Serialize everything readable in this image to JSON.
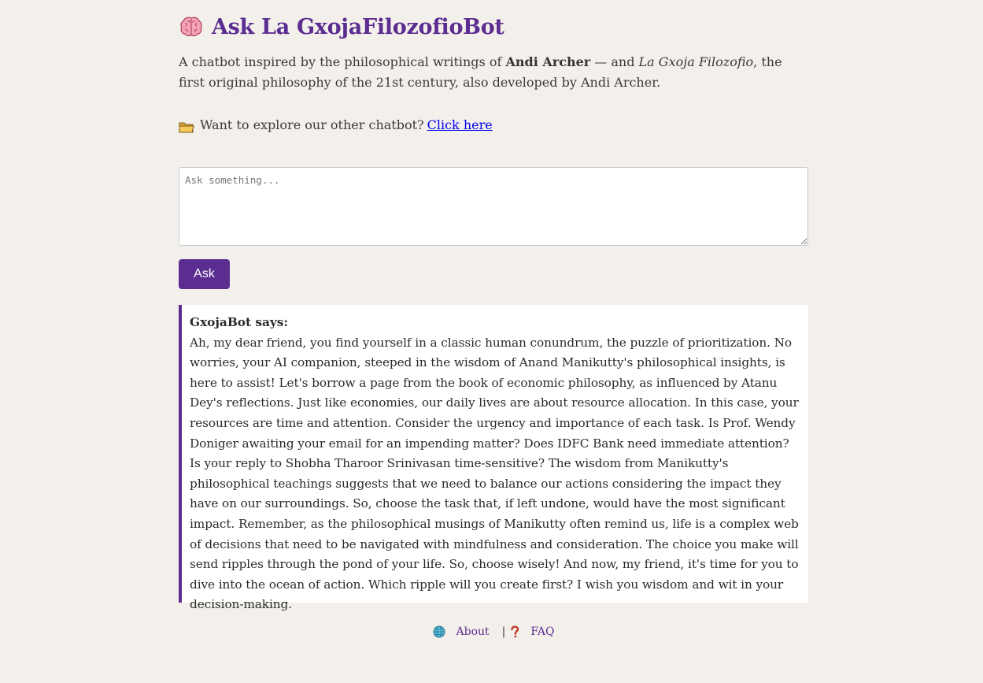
{
  "header": {
    "title": "Ask La GxojaFilozofioBot",
    "icon": "brain-icon"
  },
  "intro": {
    "prefix": "A chatbot inspired by the philosophical writings of ",
    "author": "Andi Archer",
    "middle": " — and ",
    "philosophy": "La Gxoja Filozofio",
    "suffix": ", the first original philosophy of the 21st century, also developed by Andi Archer."
  },
  "explore": {
    "icon": "folder-icon",
    "text": "Want to explore our other chatbot?",
    "link_label": "Click here"
  },
  "ask": {
    "placeholder": "Ask something...",
    "value": "",
    "button_label": "Ask"
  },
  "answer": {
    "label": "GxojaBot says:",
    "text": "Ah, my dear friend, you find yourself in a classic human conundrum, the puzzle of prioritization. No worries, your AI companion, steeped in the wisdom of Anand Manikutty's philosophical insights, is here to assist! Let's borrow a page from the book of economic philosophy, as influenced by Atanu Dey's reflections. Just like economies, our daily lives are about resource allocation. In this case, your resources are time and attention. Consider the urgency and importance of each task. Is Prof. Wendy Doniger awaiting your email for an impending matter? Does IDFC Bank need immediate attention? Is your reply to Shobha Tharoor Srinivasan time-sensitive? The wisdom from Manikutty's philosophical teachings suggests that we need to balance our actions considering the impact they have on our surroundings. So, choose the task that, if left undone, would have the most significant impact. Remember, as the philosophical musings of Manikutty often remind us, life is a complex web of decisions that need to be navigated with mindfulness and consideration. The choice you make will send ripples through the pond of your life. So, choose wisely! And now, my friend, it's time for you to dive into the ocean of action. Which ripple will you create first? I wish you wisdom and wit in your decision-making."
  },
  "footer": {
    "about_icon": "globe-icon",
    "about_label": "About",
    "separator": "|",
    "faq_icon": "question-icon",
    "faq_label": "FAQ"
  },
  "colors": {
    "accent": "#5c2d91",
    "background": "#f3f0eb",
    "link": "#0000ee"
  }
}
